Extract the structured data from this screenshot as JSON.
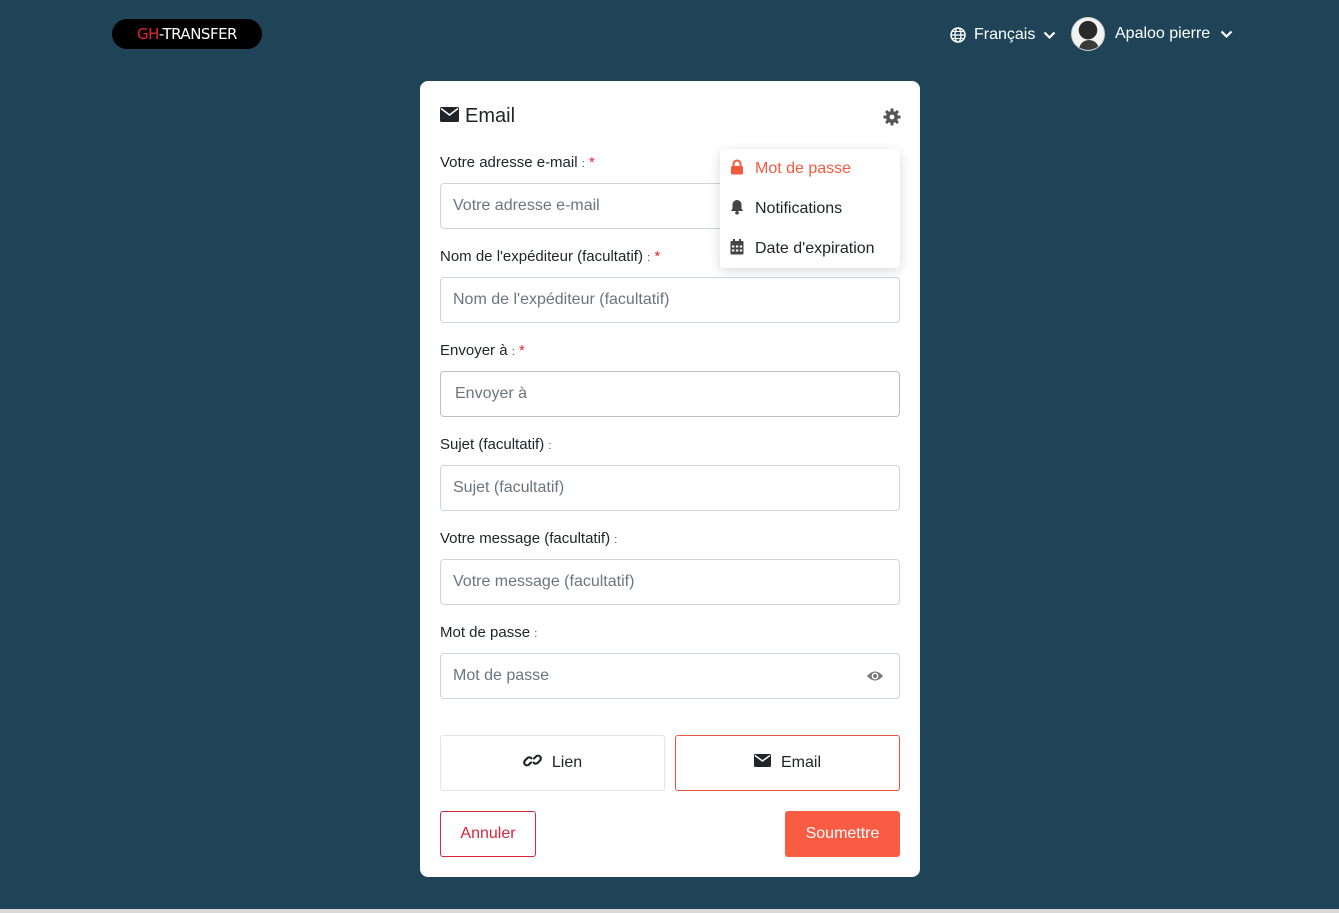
{
  "header": {
    "logo_gh": "GH",
    "logo_rest": "-TRANSFER",
    "language_label": "Français",
    "user_name": "Apaloo pierre"
  },
  "card": {
    "title": "Email",
    "fields": [
      {
        "label": "Votre adresse e-mail",
        "required": true,
        "placeholder": "Votre adresse e-mail",
        "value": ""
      },
      {
        "label": "Nom de l'expéditeur (facultatif)",
        "required": true,
        "placeholder": "Nom de l'expéditeur (facultatif)",
        "value": ""
      },
      {
        "label": "Envoyer à",
        "required": true,
        "placeholder": "Envoyer à",
        "value": ""
      },
      {
        "label": "Sujet (facultatif)",
        "required": false,
        "placeholder": "Sujet (facultatif)",
        "value": ""
      },
      {
        "label": "Votre message (facultatif)",
        "required": false,
        "placeholder": "Votre message (facultatif)",
        "value": ""
      },
      {
        "label": "Mot de passe",
        "required": false,
        "placeholder": "Mot de passe",
        "value": ""
      }
    ],
    "colon": ":",
    "required_mark": "*",
    "mode_link_label": "Lien",
    "mode_email_label": "Email",
    "cancel_label": "Annuler",
    "submit_label": "Soumettre"
  },
  "dropdown": {
    "items": [
      {
        "label": "Mot de passe",
        "icon": "lock-icon",
        "active": true
      },
      {
        "label": "Notifications",
        "icon": "bell-icon",
        "active": false
      },
      {
        "label": "Date d'expiration",
        "icon": "calendar-icon",
        "active": false
      }
    ]
  },
  "colors": {
    "background": "#1f4457",
    "accent": "#fa5c43",
    "cancel": "#d9263a",
    "required": "#e8262f"
  }
}
